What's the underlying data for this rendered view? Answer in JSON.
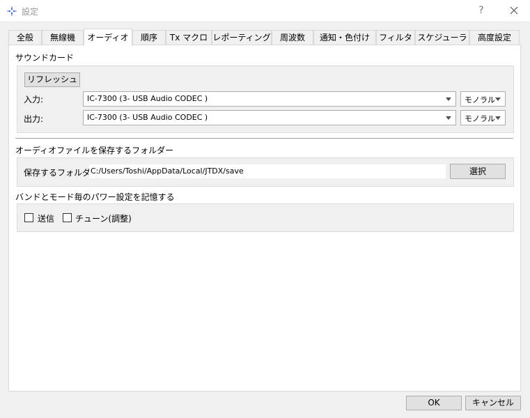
{
  "window": {
    "title": "設定",
    "help": "?"
  },
  "tabs": [
    {
      "label": "全般"
    },
    {
      "label": "無線機"
    },
    {
      "label": "オーディオ"
    },
    {
      "label": "順序"
    },
    {
      "label": "Tx マクロ"
    },
    {
      "label": "レポーティング"
    },
    {
      "label": "周波数"
    },
    {
      "label": "通知・色付け"
    },
    {
      "label": "フィルタ"
    },
    {
      "label": "スケジューラ"
    },
    {
      "label": "高度設定"
    }
  ],
  "soundcard": {
    "title": "サウンドカード",
    "refresh_label": "リフレッシュ",
    "input_label": "入力:",
    "input_device": "IC-7300 (3- USB Audio CODEC )",
    "input_channel": "モノラル",
    "output_label": "出力:",
    "output_device": "IC-7300 (3- USB Audio CODEC )",
    "output_channel": "モノラル"
  },
  "audio_folder": {
    "title": "オーディオファイルを保存するフォルダー",
    "label": "保存するフォルダー:",
    "path": "C:/Users/Toshi/AppData/Local/JTDX/save",
    "select_label": "選択"
  },
  "power": {
    "title": "バンドとモード毎のパワー設定を記憶する",
    "transmit_label": "送信",
    "tune_label": "チューン(調整)"
  },
  "footer": {
    "ok_label": "OK",
    "cancel_label": "キャンセル"
  },
  "colors": {
    "tab_border": "#d9d9d9",
    "button_bg": "#e1e1e1",
    "button_border": "#adadad",
    "icon_blue": "#3b5bdb"
  }
}
